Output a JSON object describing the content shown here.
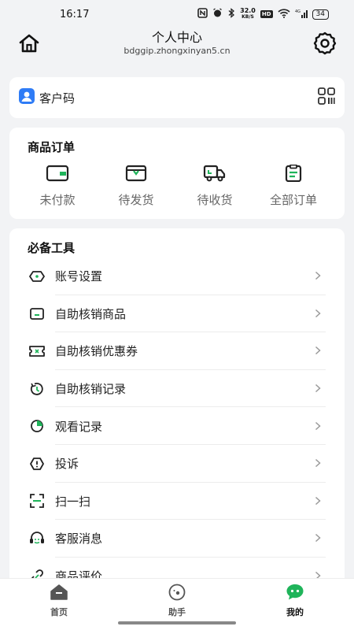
{
  "status_bar": {
    "time": "16:17",
    "network_speed_value": "32.0",
    "network_speed_unit": "KB/S",
    "hd": "HD",
    "signal": "4G",
    "battery": "34"
  },
  "header": {
    "title": "个人中心",
    "subtitle": "bdggip.zhongxinyan5.cn",
    "left_icon": "home-icon",
    "right_icon": "gear-icon"
  },
  "customer_code": {
    "label": "客户码",
    "icon": "user-badge-icon",
    "right_icon": "qrcode-icon"
  },
  "orders": {
    "title": "商品订单",
    "items": [
      {
        "label": "未付款",
        "icon": "wallet-icon"
      },
      {
        "label": "待发货",
        "icon": "box-icon"
      },
      {
        "label": "待收货",
        "icon": "truck-icon"
      },
      {
        "label": "全部订单",
        "icon": "clipboard-icon"
      }
    ]
  },
  "tools": {
    "title": "必备工具",
    "items": [
      {
        "label": "账号设置",
        "icon": "settings-icon"
      },
      {
        "label": "自助核销商品",
        "icon": "box-icon"
      },
      {
        "label": "自助核销优惠券",
        "icon": "ticket-icon"
      },
      {
        "label": "自助核销记录",
        "icon": "clock-icon"
      },
      {
        "label": "观看记录",
        "icon": "pie-icon"
      },
      {
        "label": "投诉",
        "icon": "alert-icon"
      },
      {
        "label": "扫一扫",
        "icon": "scan-icon"
      },
      {
        "label": "客服消息",
        "icon": "headset-icon"
      },
      {
        "label": "商品评价",
        "icon": "link-icon"
      }
    ]
  },
  "tabbar": {
    "items": [
      {
        "label": "首页",
        "icon": "home-tab-icon",
        "active": false
      },
      {
        "label": "助手",
        "icon": "assistant-icon",
        "active": false
      },
      {
        "label": "我的",
        "icon": "chat-bubble-icon",
        "active": true
      }
    ]
  },
  "colors": {
    "accent": "#1fb45a",
    "brand_blue": "#2f7cf6",
    "background": "#f2f3f5"
  }
}
